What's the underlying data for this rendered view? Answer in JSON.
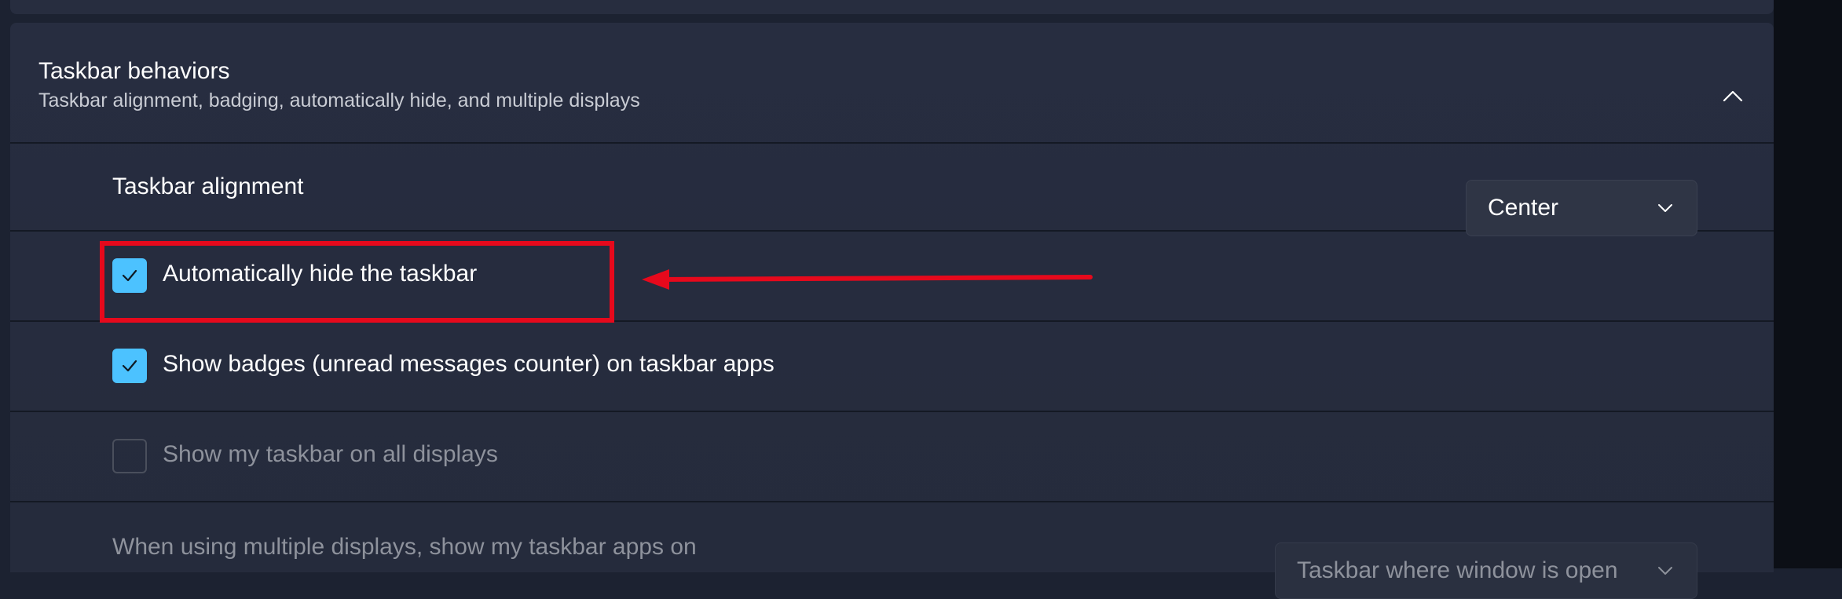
{
  "section": {
    "title": "Taskbar behaviors",
    "subtitle": "Taskbar alignment, badging, automatically hide, and multiple displays",
    "collapse_icon": "chevron-up-icon"
  },
  "settings": {
    "alignment": {
      "label": "Taskbar alignment",
      "value": "Center"
    },
    "auto_hide": {
      "label": "Automatically hide the taskbar",
      "checked": true
    },
    "badges": {
      "label": "Show badges (unread messages counter) on taskbar apps",
      "checked": true
    },
    "all_displays": {
      "label": "Show my taskbar on all displays",
      "checked": false
    },
    "multi_display": {
      "label": "When using multiple displays, show my taskbar apps on",
      "value": "Taskbar where window is open"
    }
  },
  "colors": {
    "accent": "#4cc2ff",
    "annotation": "#e6091c"
  }
}
